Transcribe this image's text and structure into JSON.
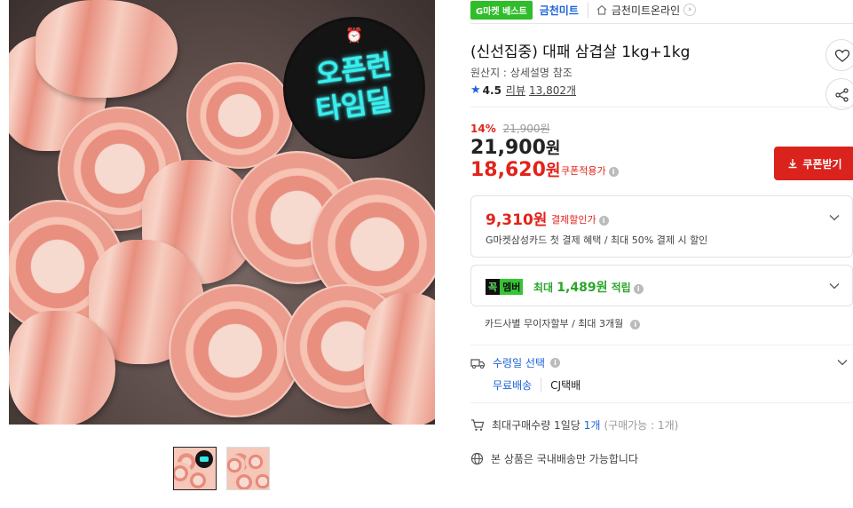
{
  "image": {
    "badge_line1": "오픈런",
    "badge_line2": "타임딜",
    "badge_color": "#36f0ee"
  },
  "tags": {
    "g_best": "G마켓 베스트",
    "seller": "금천미트",
    "store_link": "금천미트온라인",
    "store_link_icon": "home-icon"
  },
  "product": {
    "title": "(신선집중) 대패 삼겹살 1kg+1kg",
    "origin": "원산지 : 상세설명 참조",
    "rating": "4.5",
    "review_label": "리뷰",
    "review_count": "13,802개"
  },
  "price": {
    "discount_rate": "14%",
    "original": "21,900원",
    "current": "21,900",
    "current_unit": "원",
    "coupon_price": "18,620",
    "coupon_unit": "원",
    "coupon_note": "쿠폰적용가",
    "coupon_button": "쿠폰받기",
    "accent_color": "#e2231a"
  },
  "payment": {
    "price": "9,310원",
    "label": "결제할인가",
    "desc": "G마켓삼성카드 첫 결제 혜택 / 최대 50% 결제 시 할인"
  },
  "membership": {
    "badge_k": "꼭",
    "badge_m": "멤버",
    "prefix": "최대",
    "points": "1,489원",
    "suffix": "적립"
  },
  "installment": "카드사별 무이자할부 / 최대 3개월",
  "shipping": {
    "label": "수령일 선택",
    "free": "무료배송",
    "carrier": "CJ택배"
  },
  "limit": {
    "label": "최대구매수량 1일당",
    "qty": "1개",
    "note": "(구매가능 : 1개)"
  },
  "domestic": "본 상품은 국내배송만 가능합니다",
  "brand_color": "#1c63d8"
}
